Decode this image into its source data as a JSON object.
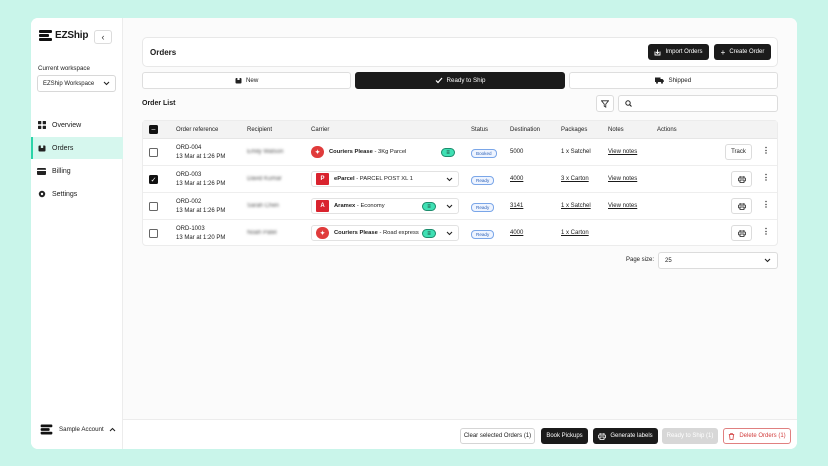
{
  "app": {
    "name": "EZShip"
  },
  "sidebar": {
    "workspace_label": "Current workspace",
    "workspace_value": "EZShip Workspace",
    "items": [
      {
        "label": "Overview",
        "icon": "grid-icon"
      },
      {
        "label": "Orders",
        "icon": "box-icon"
      },
      {
        "label": "Billing",
        "icon": "card-icon"
      },
      {
        "label": "Settings",
        "icon": "gear-icon"
      }
    ],
    "active_item": "Orders",
    "account_label": "Sample Account"
  },
  "header": {
    "title": "Orders",
    "import_label": "Import Orders",
    "create_label": "Create Order"
  },
  "tabs": [
    {
      "label": "New",
      "active": false
    },
    {
      "label": "Ready to Ship",
      "active": true
    },
    {
      "label": "Shipped",
      "active": false
    }
  ],
  "order_list": {
    "title": "Order List",
    "columns": [
      "Order reference",
      "Recipient",
      "Carrier",
      "Status",
      "Destination",
      "Packages",
      "Notes",
      "Actions"
    ],
    "rows": [
      {
        "ref": "ORD-004",
        "date": "13 Mar at 1:26 PM",
        "recipient": "Emily Watson",
        "carrier_name": "Couriers Please",
        "carrier_service": "3Kg Parcel",
        "carrier_color": "#e03b3b",
        "status": "Booked",
        "destination": "5000",
        "packages": "1 x Satchel",
        "notes": "View notes",
        "action": "Track",
        "checked": false
      },
      {
        "ref": "ORD-003",
        "date": "13 Mar at 1:26 PM",
        "recipient": "David Kumar",
        "carrier_name": "eParcel",
        "carrier_service": "PARCEL POST XL 1",
        "carrier_color": "#d9232e",
        "status": "Ready",
        "destination": "4000",
        "packages": "3 x Carton",
        "notes": "View notes",
        "action": "print",
        "checked": true
      },
      {
        "ref": "ORD-002",
        "date": "13 Mar at 1:26 PM",
        "recipient": "Sarah Chen",
        "carrier_name": "Aramex",
        "carrier_service": "Economy",
        "carrier_color": "#d9232e",
        "status": "Ready",
        "destination": "3141",
        "packages": "1 x Satchel",
        "notes": "View notes",
        "action": "print",
        "checked": false
      },
      {
        "ref": "ORD-1003",
        "date": "13 Mar at 1:20 PM",
        "recipient": "Noah Patel",
        "carrier_name": "Couriers Please",
        "carrier_service": "Road express",
        "carrier_color": "#e03b3b",
        "status": "Ready",
        "destination": "4000",
        "packages": "1 x Carton",
        "notes": "",
        "action": "print",
        "checked": false
      }
    ]
  },
  "pagination": {
    "label": "Page size:",
    "value": "25"
  },
  "footer": {
    "clear_label": "Clear selected Orders (1)",
    "book_label": "Book Pickups",
    "generate_label": "Generate labels",
    "ready_label": "Ready to Ship (1)",
    "delete_label": "Delete Orders (1)"
  },
  "colors": {
    "accent": "#2bd4a8",
    "dark": "#1b1b1b",
    "danger": "#d23d3d",
    "background": "#c9f5ea"
  }
}
